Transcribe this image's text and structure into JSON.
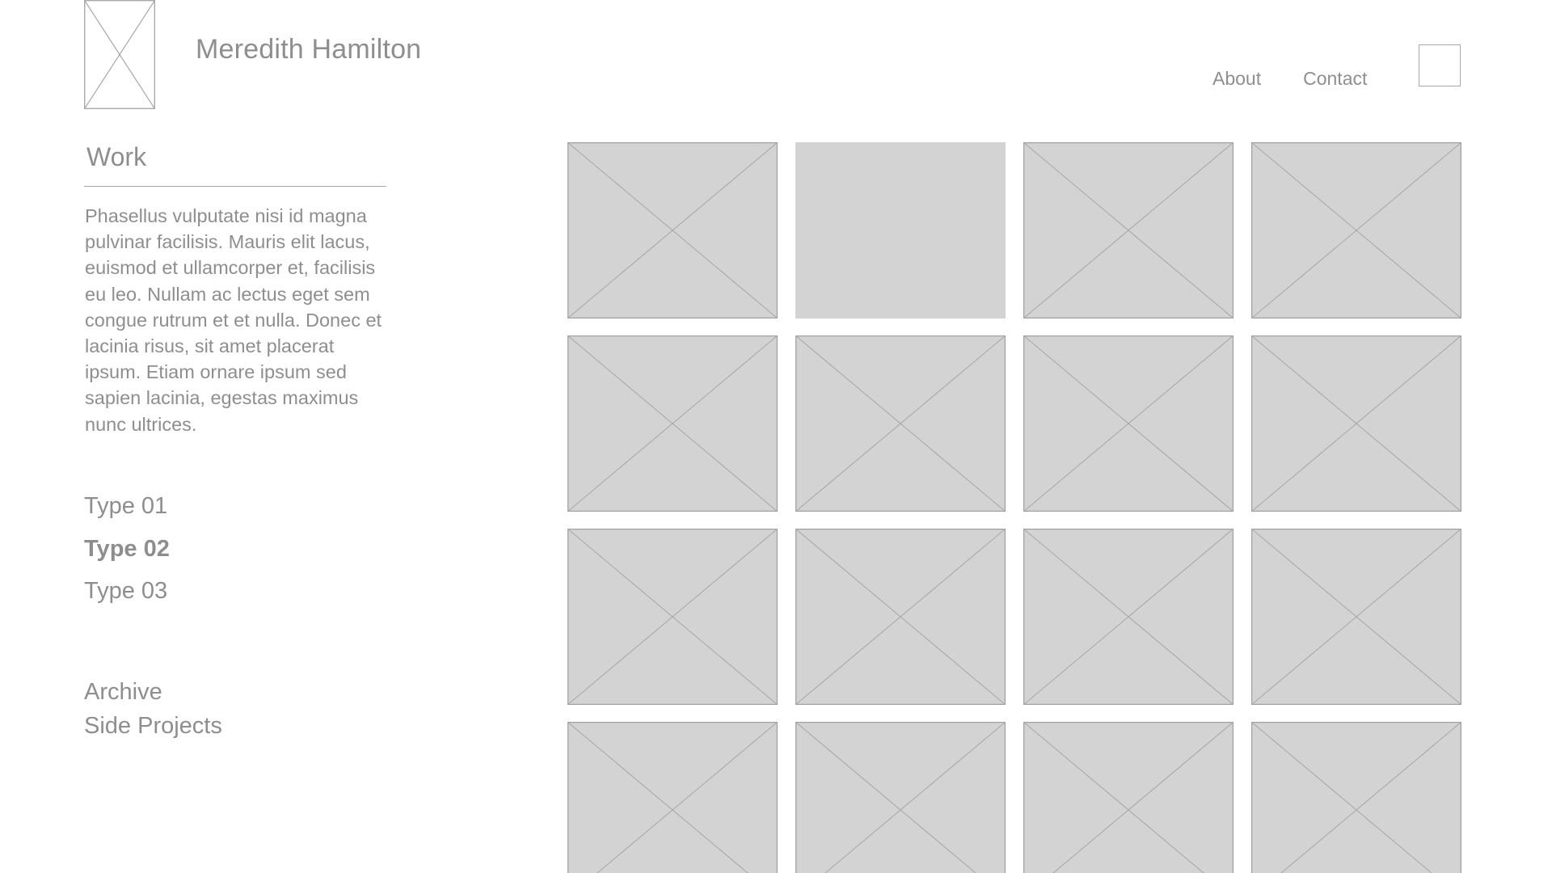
{
  "header": {
    "site_name": "Meredith Hamilton",
    "logo_icon": "image-placeholder-icon",
    "nav": [
      {
        "label": "About"
      },
      {
        "label": "Contact"
      }
    ],
    "menu_icon": "menu-box-icon"
  },
  "sidebar": {
    "section_title": "Work",
    "description": "Phasellus vulputate nisi id magna pulvinar facilisis. Mauris elit lacus, euismod et ullamcorper et, facilisis eu leo. Nullam ac lectus eget sem congue rutrum et et nulla. Donec et lacinia risus, sit amet placerat ipsum. Etiam ornare ipsum sed sapien lacinia, egestas maximus nunc ultrices.",
    "types": [
      {
        "label": "Type 01",
        "active": false
      },
      {
        "label": "Type 02",
        "active": true
      },
      {
        "label": "Type 03",
        "active": false
      }
    ],
    "extra_links": [
      {
        "label": "Archive"
      },
      {
        "label": "Side Projects"
      }
    ]
  },
  "gallery": {
    "tiles": [
      {
        "placeholder": true
      },
      {
        "placeholder": false
      },
      {
        "placeholder": true
      },
      {
        "placeholder": true
      },
      {
        "placeholder": true
      },
      {
        "placeholder": true
      },
      {
        "placeholder": true
      },
      {
        "placeholder": true
      },
      {
        "placeholder": true
      },
      {
        "placeholder": true
      },
      {
        "placeholder": true
      },
      {
        "placeholder": true
      },
      {
        "placeholder": true
      },
      {
        "placeholder": true
      },
      {
        "placeholder": true
      },
      {
        "placeholder": true
      }
    ]
  },
  "colors": {
    "text": "#8e8e8e",
    "tile_fill": "#d3d3d3",
    "line": "#a5a5a5"
  }
}
